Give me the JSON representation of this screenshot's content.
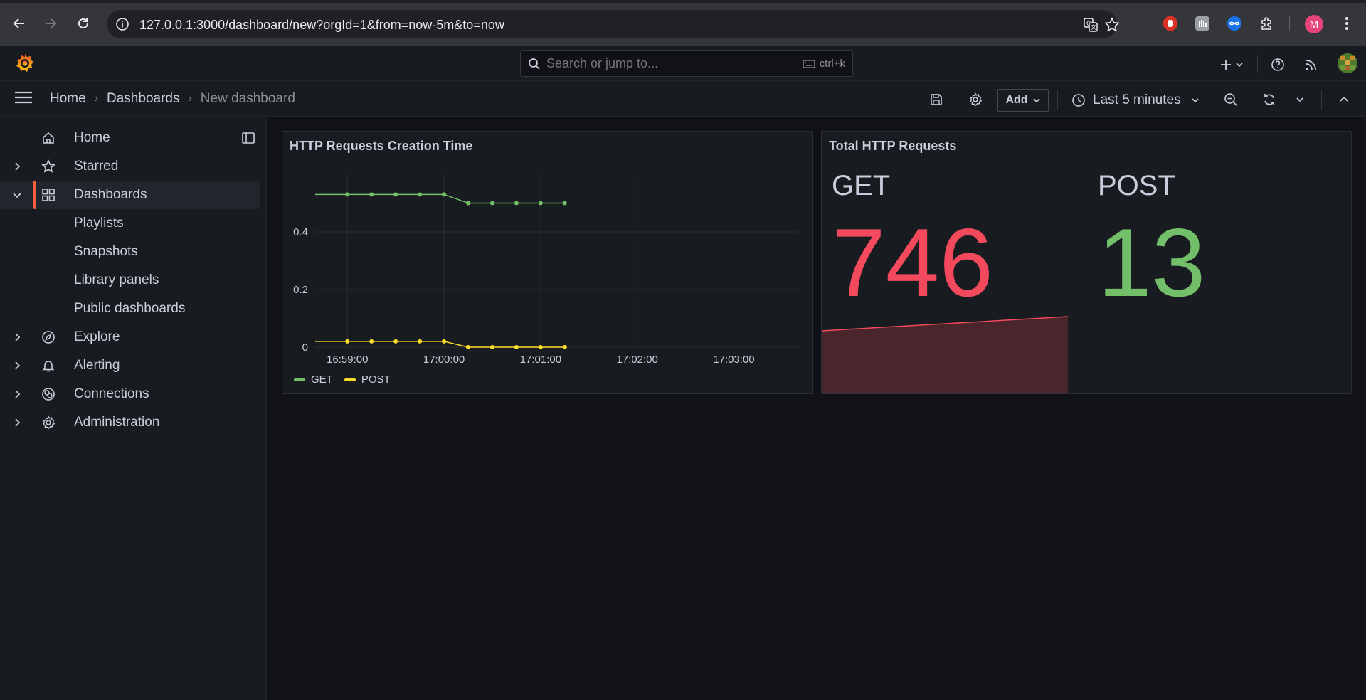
{
  "browser": {
    "url": "127.0.0.1:3000/dashboard/new?orgId=1&from=now-5m&to=now",
    "profile_initial": "M"
  },
  "topbar": {
    "search_placeholder": "Search or jump to...",
    "shortcut": "ctrl+k"
  },
  "breadcrumb": {
    "home": "Home",
    "dashboards": "Dashboards",
    "current": "New dashboard"
  },
  "toolbar": {
    "add_label": "Add",
    "time_range": "Last 5 minutes"
  },
  "sidebar": {
    "items": [
      {
        "label": "Home",
        "icon": "home-icon"
      },
      {
        "label": "Starred",
        "icon": "star-icon"
      },
      {
        "label": "Dashboards",
        "icon": "apps-icon"
      },
      {
        "label": "Playlists"
      },
      {
        "label": "Snapshots"
      },
      {
        "label": "Library panels"
      },
      {
        "label": "Public dashboards"
      },
      {
        "label": "Explore",
        "icon": "compass-icon"
      },
      {
        "label": "Alerting",
        "icon": "bell-icon"
      },
      {
        "label": "Connections",
        "icon": "connections-icon"
      },
      {
        "label": "Administration",
        "icon": "gear-icon"
      }
    ]
  },
  "panels": {
    "timeseries": {
      "title": "HTTP Requests Creation Time"
    },
    "stat": {
      "title": "Total HTTP Requests",
      "get_name": "GET",
      "get_value": "746",
      "post_name": "POST",
      "post_value": "13"
    }
  },
  "colors": {
    "get": "#73bf69",
    "post": "#fade2a",
    "stat_red": "#f2495c",
    "stat_green": "#73bf69",
    "accent": "#f55f3e"
  },
  "chart_data": {
    "type": "line",
    "title": "HTTP Requests Creation Time",
    "x": [
      "16:58:40",
      "16:59:00",
      "16:59:15",
      "16:59:30",
      "16:59:45",
      "17:00:00",
      "17:00:15",
      "17:00:30",
      "17:00:45",
      "17:01:00",
      "17:01:15"
    ],
    "x_ticks": [
      "16:59:00",
      "17:00:00",
      "17:01:00",
      "17:02:00",
      "17:03:00"
    ],
    "y_ticks": [
      "0",
      "0.2",
      "0.4"
    ],
    "ylim": [
      0,
      0.6
    ],
    "grid": true,
    "legend_position": "bottom-left",
    "series": [
      {
        "name": "GET",
        "color": "#73bf69",
        "values": [
          0.53,
          0.53,
          0.53,
          0.53,
          0.53,
          0.53,
          0.5,
          0.5,
          0.5,
          0.5,
          0.5
        ]
      },
      {
        "name": "POST",
        "color": "#fade2a",
        "values": [
          0.02,
          0.02,
          0.02,
          0.02,
          0.02,
          0.02,
          0.0,
          0.0,
          0.0,
          0.0,
          0.0
        ]
      }
    ]
  }
}
